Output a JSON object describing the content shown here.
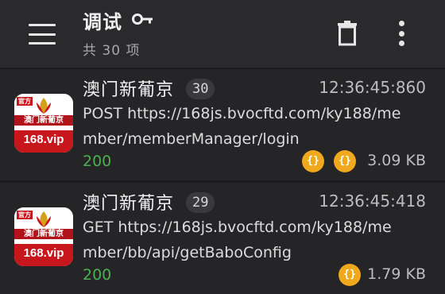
{
  "header": {
    "title": "调试",
    "subtitle": "共 30 项"
  },
  "colors": {
    "accent_status_ok": "#4caf50",
    "json_chip": "#f0a81c",
    "app_icon_red": "#c8161d"
  },
  "requests": [
    {
      "app_name": "澳门新葡京",
      "count": "30",
      "time": "12:36:45:860",
      "line1": "POST https://168js.bvocftd.com/ky188/me",
      "line2": "mber/memberManager/login",
      "status": "200",
      "chips": [
        "{}",
        "{}"
      ],
      "size": "3.09 KB",
      "icon": {
        "badge": "官方",
        "name": "澳门新葡京",
        "url": "168.vip"
      }
    },
    {
      "app_name": "澳门新葡京",
      "count": "29",
      "time": "12:36:45:418",
      "line1": "GET https://168js.bvocftd.com/ky188/me",
      "line2": "mber/bb/api/getBaboConfig",
      "status": "200",
      "chips": [
        "{}"
      ],
      "size": "1.79 KB",
      "icon": {
        "badge": "官方",
        "name": "澳门新葡京",
        "url": "168.vip"
      }
    }
  ]
}
